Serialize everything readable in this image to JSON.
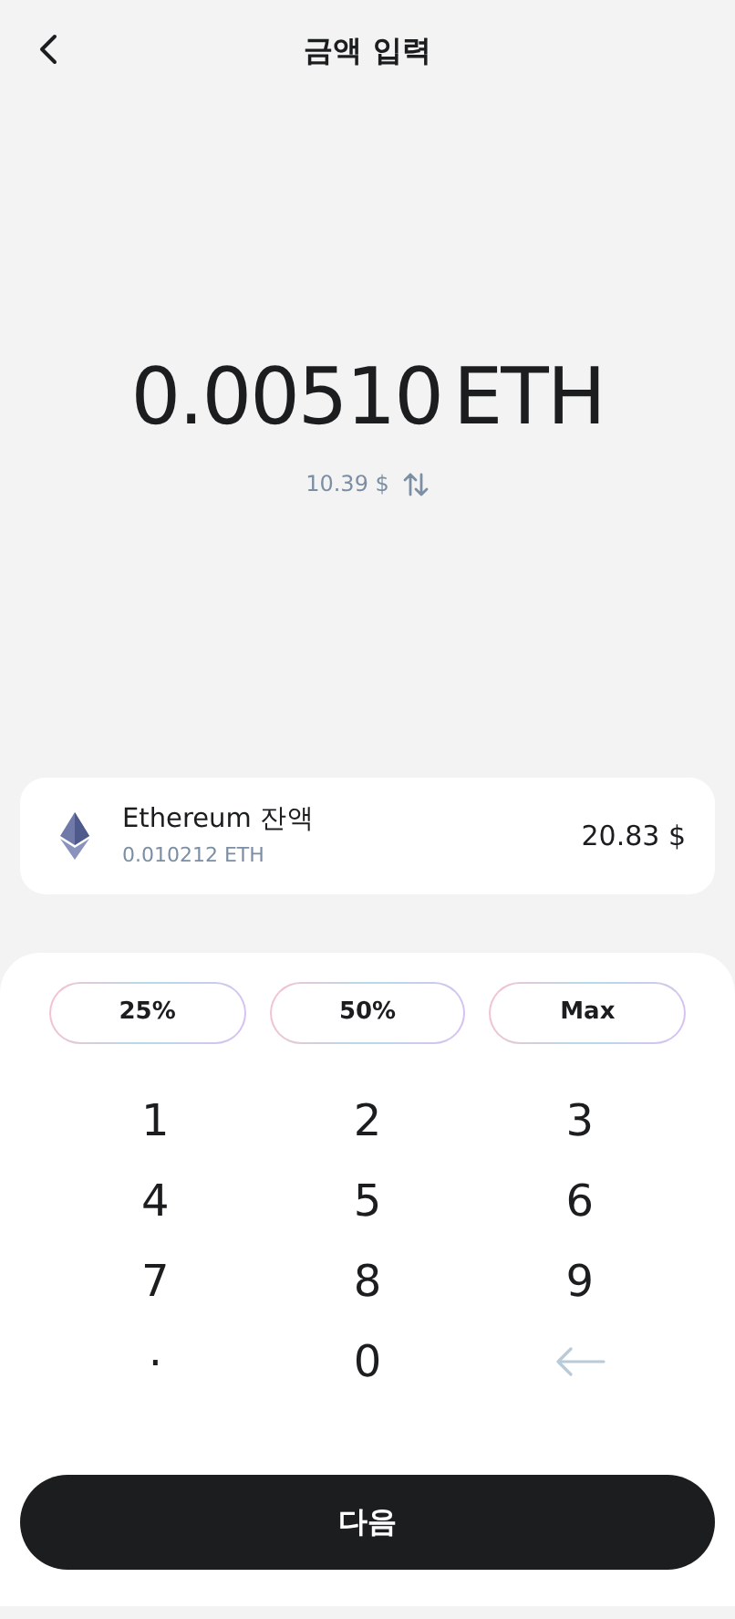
{
  "header": {
    "title": "금액 입력"
  },
  "amount": {
    "value": "0.00510",
    "unit": "ETH",
    "fiat": "10.39 $"
  },
  "balance": {
    "name": "Ethereum 잔액",
    "amount": "0.010212 ETH",
    "fiat": "20.83 $"
  },
  "presets": [
    "25%",
    "50%",
    "Max"
  ],
  "keypad": [
    {
      "kind": "digit",
      "label": "1"
    },
    {
      "kind": "digit",
      "label": "2"
    },
    {
      "kind": "digit",
      "label": "3"
    },
    {
      "kind": "digit",
      "label": "4"
    },
    {
      "kind": "digit",
      "label": "5"
    },
    {
      "kind": "digit",
      "label": "6"
    },
    {
      "kind": "digit",
      "label": "7"
    },
    {
      "kind": "digit",
      "label": "8"
    },
    {
      "kind": "digit",
      "label": "9"
    },
    {
      "kind": "decimal",
      "label": "."
    },
    {
      "kind": "digit",
      "label": "0"
    },
    {
      "kind": "backspace"
    }
  ],
  "next_button": "다음"
}
